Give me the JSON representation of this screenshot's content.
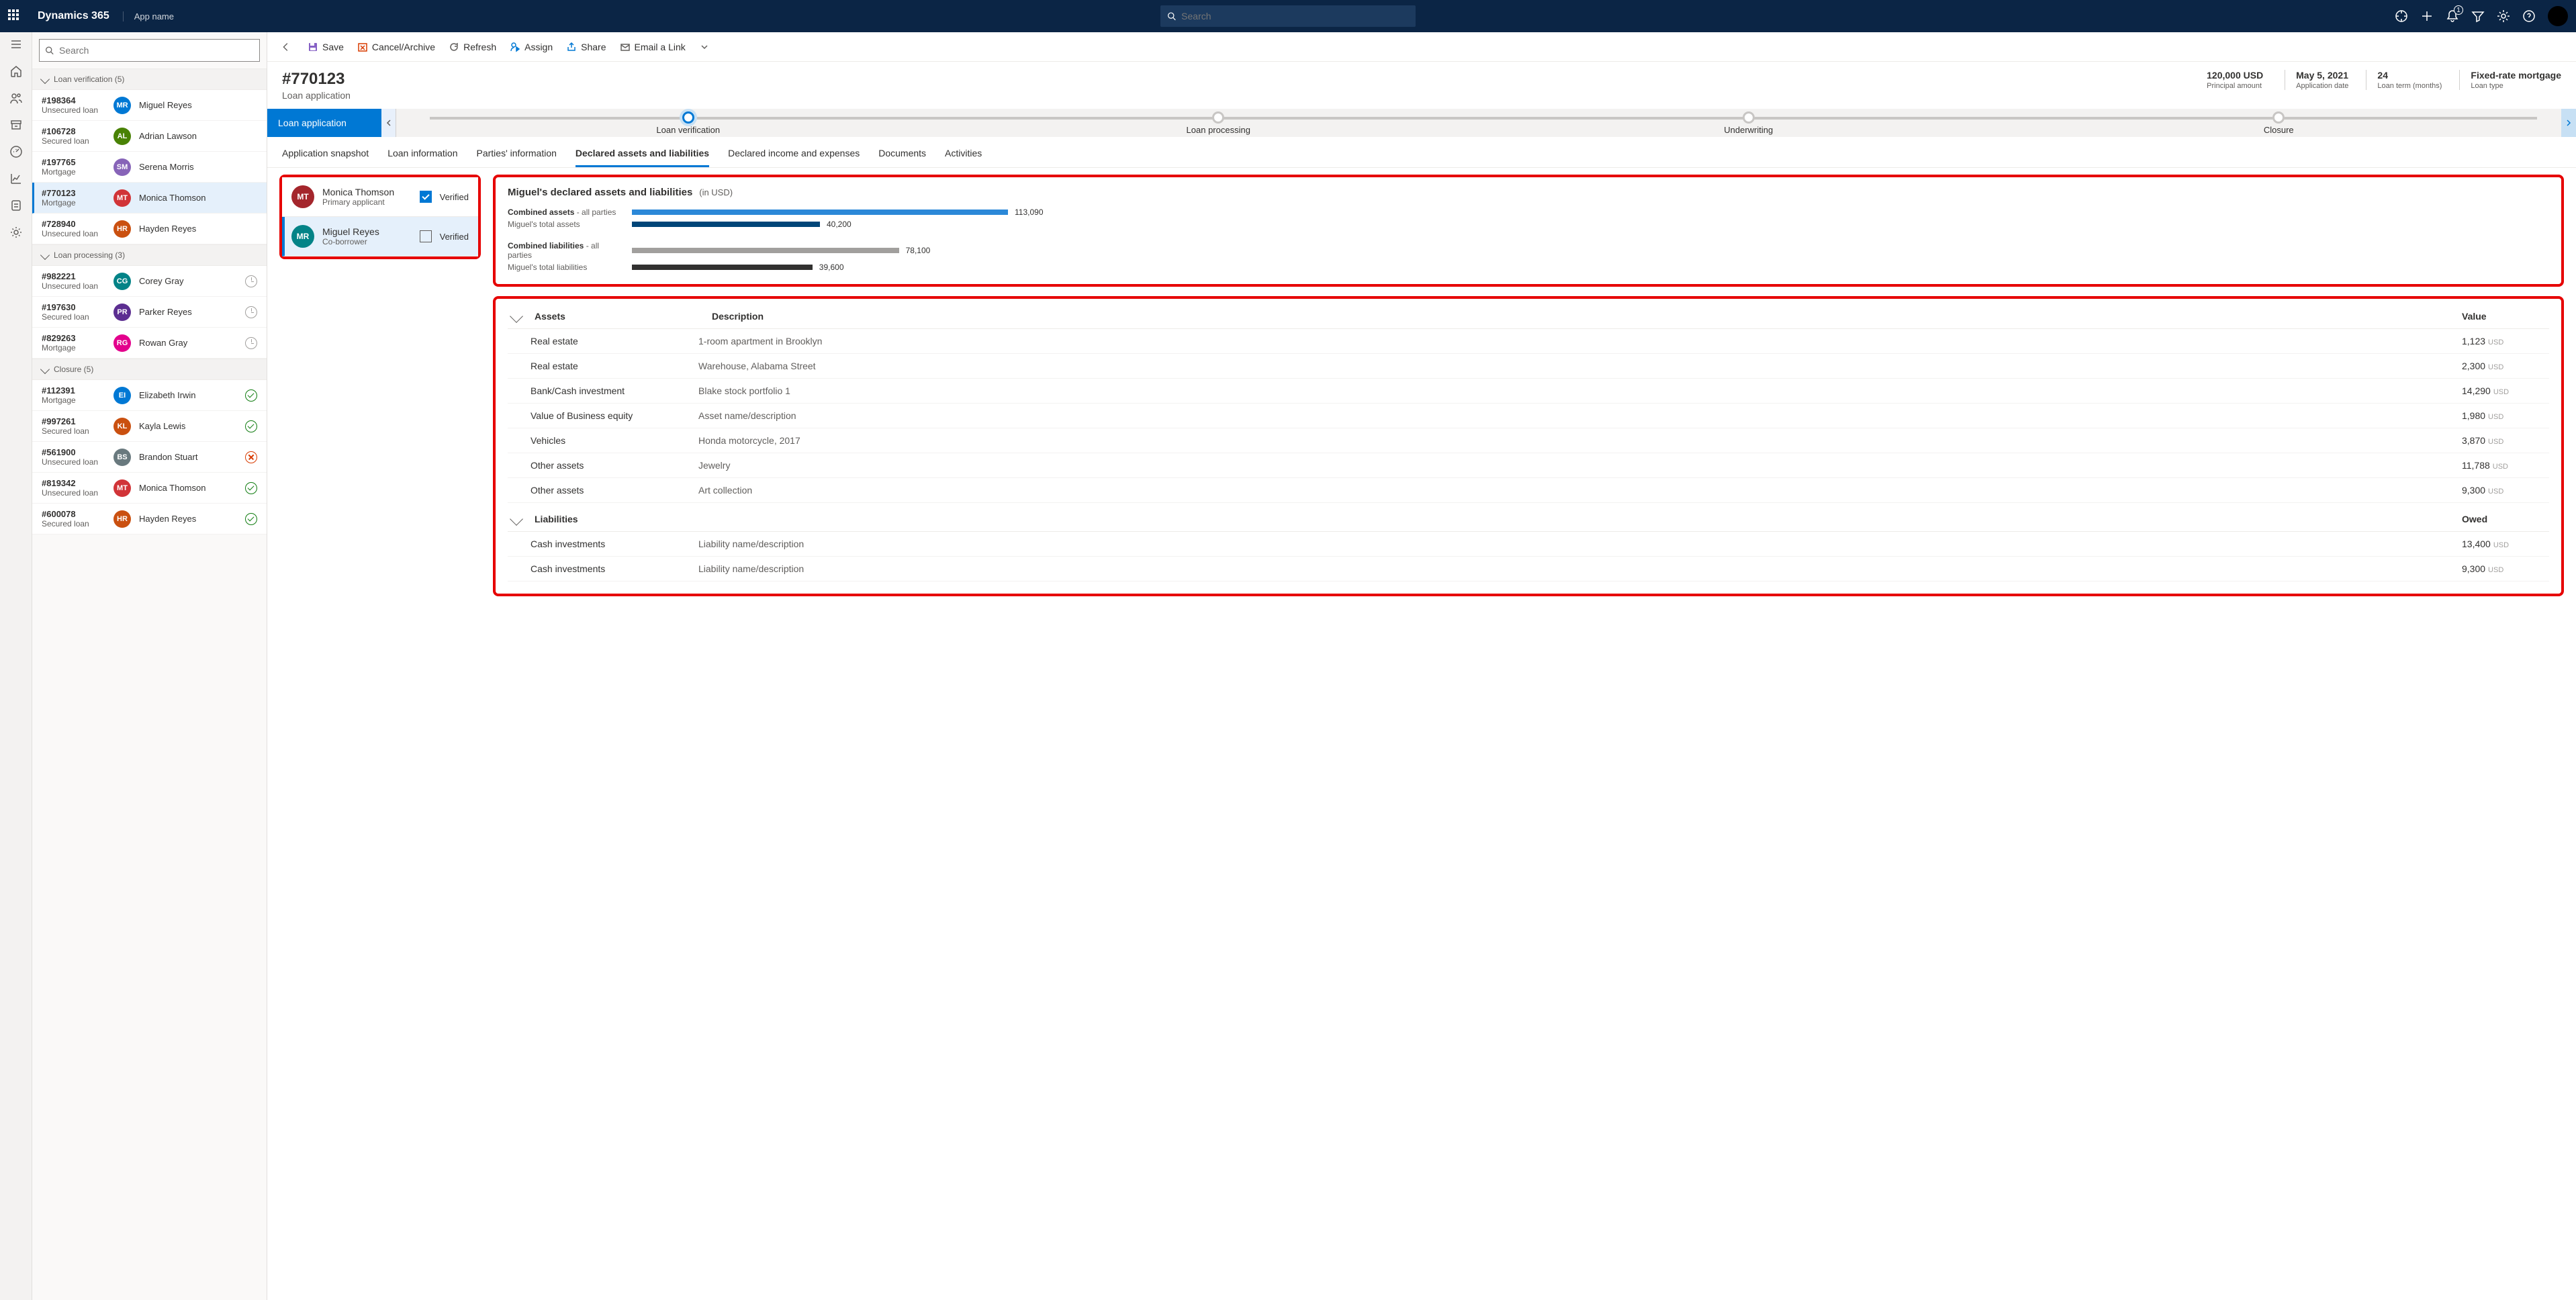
{
  "topbar": {
    "brand": "Dynamics 365",
    "appname": "App name",
    "search_placeholder": "Search",
    "notification_count": "1"
  },
  "listpane": {
    "search_placeholder": "Search",
    "groups": [
      {
        "label": "Loan verification (5)",
        "items": [
          {
            "id": "#198364",
            "type": "Unsecured loan",
            "initials": "MR",
            "color": "#0078d4",
            "name": "Miguel Reyes",
            "status": ""
          },
          {
            "id": "#106728",
            "type": "Secured loan",
            "initials": "AL",
            "color": "#498205",
            "name": "Adrian Lawson",
            "status": ""
          },
          {
            "id": "#197765",
            "type": "Mortgage",
            "initials": "SM",
            "color": "#8764b8",
            "name": "Serena Morris",
            "status": ""
          },
          {
            "id": "#770123",
            "type": "Mortgage",
            "initials": "MT",
            "color": "#d13438",
            "name": "Monica Thomson",
            "status": "",
            "selected": true
          },
          {
            "id": "#728940",
            "type": "Unsecured loan",
            "initials": "HR",
            "color": "#ca5010",
            "name": "Hayden Reyes",
            "status": ""
          }
        ]
      },
      {
        "label": "Loan processing (3)",
        "items": [
          {
            "id": "#982221",
            "type": "Unsecured loan",
            "initials": "CG",
            "color": "#038387",
            "name": "Corey Gray",
            "status": "clock"
          },
          {
            "id": "#197630",
            "type": "Secured loan",
            "initials": "PR",
            "color": "#5c2e91",
            "name": "Parker Reyes",
            "status": "clock"
          },
          {
            "id": "#829263",
            "type": "Mortgage",
            "initials": "RG",
            "color": "#e3008c",
            "name": "Rowan Gray",
            "status": "clock"
          }
        ]
      },
      {
        "label": "Closure (5)",
        "items": [
          {
            "id": "#112391",
            "type": "Mortgage",
            "initials": "EI",
            "color": "#0078d4",
            "name": "Elizabeth Irwin",
            "status": "ok"
          },
          {
            "id": "#997261",
            "type": "Secured loan",
            "initials": "KL",
            "color": "#ca5010",
            "name": "Kayla Lewis",
            "status": "ok"
          },
          {
            "id": "#561900",
            "type": "Unsecured loan",
            "initials": "BS",
            "color": "#69797e",
            "name": "Brandon Stuart",
            "status": "x"
          },
          {
            "id": "#819342",
            "type": "Unsecured loan",
            "initials": "MT",
            "color": "#d13438",
            "name": "Monica Thomson",
            "status": "ok"
          },
          {
            "id": "#600078",
            "type": "Secured loan",
            "initials": "HR",
            "color": "#ca5010",
            "name": "Hayden Reyes",
            "status": "ok"
          }
        ]
      }
    ]
  },
  "commands": {
    "save": "Save",
    "cancel": "Cancel/Archive",
    "refresh": "Refresh",
    "assign": "Assign",
    "share": "Share",
    "email": "Email a Link"
  },
  "record": {
    "title": "#770123",
    "subtitle": "Loan application",
    "kpis": [
      {
        "v": "120,000 USD",
        "l": "Principal amount"
      },
      {
        "v": "May 5, 2021",
        "l": "Application date"
      },
      {
        "v": "24",
        "l": "Loan term (months)"
      },
      {
        "v": "Fixed-rate mortgage",
        "l": "Loan type"
      }
    ]
  },
  "stagebar": {
    "label": "Loan application",
    "stages": [
      "Loan verification",
      "Loan processing",
      "Underwriting",
      "Closure"
    ],
    "active": 0
  },
  "tabs": [
    "Application snapshot",
    "Loan information",
    "Parties' information",
    "Declared assets and liabilities",
    "Declared income and expenses",
    "Documents",
    "Activities"
  ],
  "active_tab": 3,
  "parties": [
    {
      "initials": "MT",
      "color": "#a4262c",
      "name": "Monica Thomson",
      "role": "Primary applicant",
      "verified": true,
      "verified_label": "Verified"
    },
    {
      "initials": "MR",
      "color": "#038387",
      "name": "Miguel Reyes",
      "role": "Co-borrower",
      "verified": false,
      "verified_label": "Verified",
      "selected": true
    }
  ],
  "summary": {
    "title": "Miguel's declared assets and liabilities",
    "unit": "(in USD)",
    "groups": [
      {
        "rows": [
          {
            "label_bold": "Combined assets",
            "label_rest": " - all parties",
            "value": "113,090",
            "pct": 100,
            "cls": "bbar"
          },
          {
            "label_bold": "",
            "label_rest": "Miguel's total  assets",
            "value": "40,200",
            "pct": 50,
            "cls": "bbar dark"
          }
        ]
      },
      {
        "rows": [
          {
            "label_bold": "Combined liabilities",
            "label_rest": " - all parties",
            "value": "78,100",
            "pct": 71,
            "cls": "bbar grey"
          },
          {
            "label_bold": "",
            "label_rest": "Miguel's total  liabilities",
            "value": "39,600",
            "pct": 48,
            "cls": "bbar dgrey"
          }
        ]
      }
    ]
  },
  "assets": {
    "header": {
      "c1": "Assets",
      "c2": "Description",
      "c3": "Value"
    },
    "rows": [
      {
        "c1": "Real estate",
        "c2": "1-room apartment in Brooklyn",
        "c3": "1,123"
      },
      {
        "c1": "Real estate",
        "c2": "Warehouse, Alabama Street",
        "c3": "2,300"
      },
      {
        "c1": "Bank/Cash investment",
        "c2": "Blake stock portfolio 1",
        "c3": "14,290"
      },
      {
        "c1": "Value of Business equity",
        "c2": "Asset name/description",
        "c3": "1,980"
      },
      {
        "c1": "Vehicles",
        "c2": "Honda motorcycle, 2017",
        "c3": "3,870"
      },
      {
        "c1": "Other assets",
        "c2": "Jewelry",
        "c3": "11,788"
      },
      {
        "c1": "Other assets",
        "c2": "Art collection",
        "c3": "9,300"
      }
    ]
  },
  "liabilities": {
    "header": {
      "c1": "Liabilities",
      "c2": "",
      "c3": "Owed"
    },
    "rows": [
      {
        "c1": "Cash investments",
        "c2": "Liability name/description",
        "c3": "13,400"
      },
      {
        "c1": "Cash investments",
        "c2": "Liability name/description",
        "c3": "9,300"
      }
    ]
  },
  "currency": "USD"
}
